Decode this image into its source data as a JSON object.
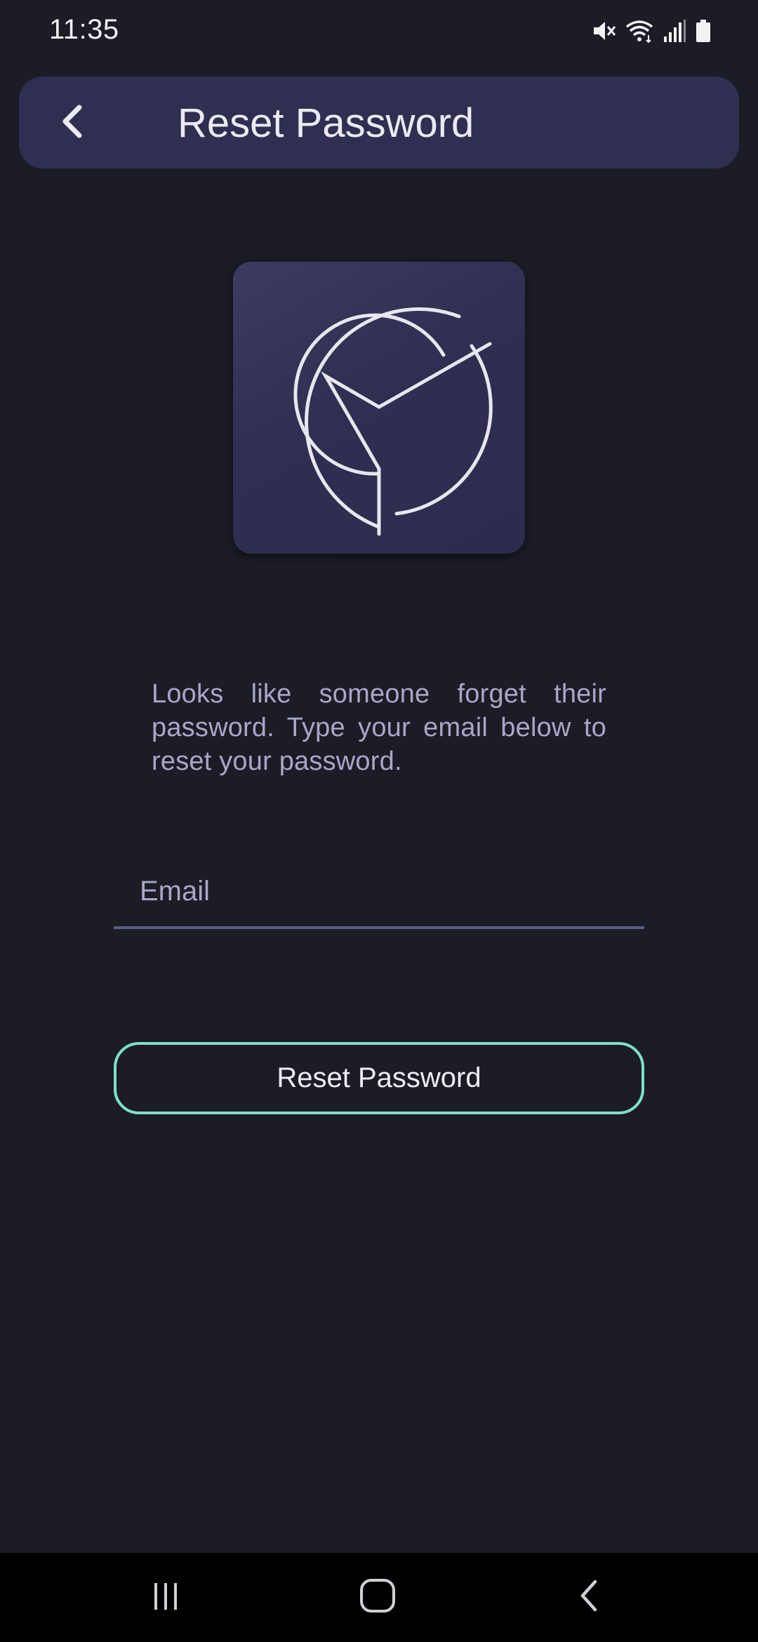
{
  "status_bar": {
    "time": "11:35",
    "icons": [
      "mute-icon",
      "wifi-icon",
      "signal-icon",
      "battery-icon"
    ]
  },
  "app_bar": {
    "title": "Reset Password",
    "back_icon": "chevron-left-icon"
  },
  "logo": {
    "icon": "clock-logo-icon"
  },
  "description": "Looks like someone forget their password. Type your email below to reset your password.",
  "email_field": {
    "placeholder": "Email",
    "value": ""
  },
  "reset_button": {
    "label": "Reset Password"
  },
  "nav_bar": {
    "items": [
      "recent-apps-icon",
      "home-icon",
      "back-icon"
    ]
  },
  "colors": {
    "background": "#1c1c26",
    "app_bar": "#2f2f52",
    "accent": "#7fe0c8",
    "muted_text": "#a9a6c8",
    "underline": "#5f5c84"
  }
}
